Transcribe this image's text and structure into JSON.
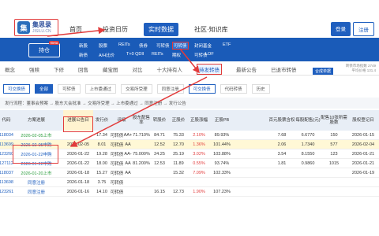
{
  "logo": {
    "name": "集思录",
    "sub": "JISILU.CN"
  },
  "nav": [
    "首页",
    "投资日历",
    "实时数据",
    "社区·知识库"
  ],
  "login": {
    "login": "登录",
    "register": "注册"
  },
  "sub": {
    "hold": "持仓",
    "beta": "Beta",
    "row1": [
      "新股",
      "股票",
      "REITs",
      "债券",
      "可转债",
      "封闭基金",
      "ETF"
    ],
    "row2": [
      "新债",
      "A/H比价",
      "T+0 QDII",
      "REITs",
      "期权",
      "可转债",
      "LOF"
    ]
  },
  "tabs1": [
    "概念",
    "强赎",
    "下修",
    "回售",
    "藏宝图",
    "对比",
    "十大持有人",
    "待发转债",
    "最新公告",
    "已退市转债"
  ],
  "tabs1_right": "合成单据",
  "sideinfo": [
    "转债市场指数 2749",
    "平均价格 131.4"
  ],
  "tabs2": [
    "可交换债",
    "全部",
    "可转债",
    "上市委通过",
    "交易所受理",
    "同意注册",
    "可交换债",
    "代码转债",
    "历史"
  ],
  "flow": "发行流程：董事会预案 → 股东大会批准 → 交易所受理 → 上市委通过 → 同意注册 → 发行公告",
  "headers": [
    "代码",
    "方案进展",
    "进展公告日",
    "发行价",
    "评级",
    "股东配售率",
    "转股价",
    "正股价",
    "正股涨幅",
    "正股PB",
    "百元股票含权",
    "每股配售(元)",
    "配售10张所需股数",
    "股权登记日"
  ],
  "rows": [
    {
      "code": "118034",
      "prog": "2026-02-05上市",
      "date": "",
      "price": "17.34",
      "type": "可转债",
      "rating": "AA+",
      "rate": "71.710%",
      "conv": "84.71",
      "stock": "75.33",
      "chg": "2.10%",
      "pb": "89.93%",
      "c1": "7.68",
      "c2": "6.6770",
      "c3": "150",
      "reg": "2026-01-15"
    },
    {
      "code": "113699",
      "prog": "2026-02-05申购",
      "date": "2026-02-05",
      "price": "8.01",
      "type": "可转债",
      "rating": "AA",
      "rate": "",
      "conv": "12.52",
      "stock": "12.70",
      "chg": "1.36%",
      "pb": "101.44%",
      "c1": "2.06",
      "c2": "1.7340",
      "c3": "577",
      "reg": "2026-02-04"
    },
    {
      "code": "123260",
      "prog": "2026-01-22申购",
      "date": "2026-01-22",
      "price": "19.28",
      "type": "可转债",
      "rating": "AA-",
      "rate": "75.000%",
      "conv": "24.25",
      "stock": "25.19",
      "chg": "3.02%",
      "pb": "103.88%",
      "c1": "3.54",
      "c2": "8.1550",
      "c3": "123",
      "reg": "2026-01-21"
    },
    {
      "code": "127112",
      "prog": "2026-01-22申购",
      "date": "2026-01-22",
      "price": "18.00",
      "type": "可转债",
      "rating": "AA",
      "rate": "81.200%",
      "conv": "12.53",
      "stock": "11.89",
      "chg": "0.55%",
      "pb": "93.74%",
      "c1": "1.81",
      "c2": "0.9860",
      "c3": "1015",
      "reg": "2026-01-21"
    },
    {
      "code": "118037",
      "prog": "2026-01-20上市",
      "date": "2026-01-18",
      "price": "15.27",
      "type": "可转债",
      "rating": "AA",
      "rate": "",
      "conv": "",
      "stock": "15.32",
      "chg": "7.09%",
      "pb": "102.33%",
      "c1": "",
      "c2": "",
      "c3": "",
      "reg": "2026-01-19"
    },
    {
      "code": "113698",
      "prog": "同意注册",
      "date": "2026-01-18",
      "price": "3.75",
      "type": "可转债",
      "rating": "",
      "rate": "",
      "conv": "",
      "stock": "",
      "chg": "",
      "pb": "",
      "c1": "",
      "c2": "",
      "c3": "",
      "reg": ""
    },
    {
      "code": "123261",
      "prog": "同意注册",
      "date": "2026-01-16",
      "price": "14.10",
      "type": "可转债",
      "rating": "",
      "rate": "",
      "conv": "16.15",
      "stock": "12.73",
      "chg": "1.90%",
      "pb": "107.23%",
      "c1": "",
      "c2": "",
      "c3": "",
      "reg": ""
    }
  ]
}
